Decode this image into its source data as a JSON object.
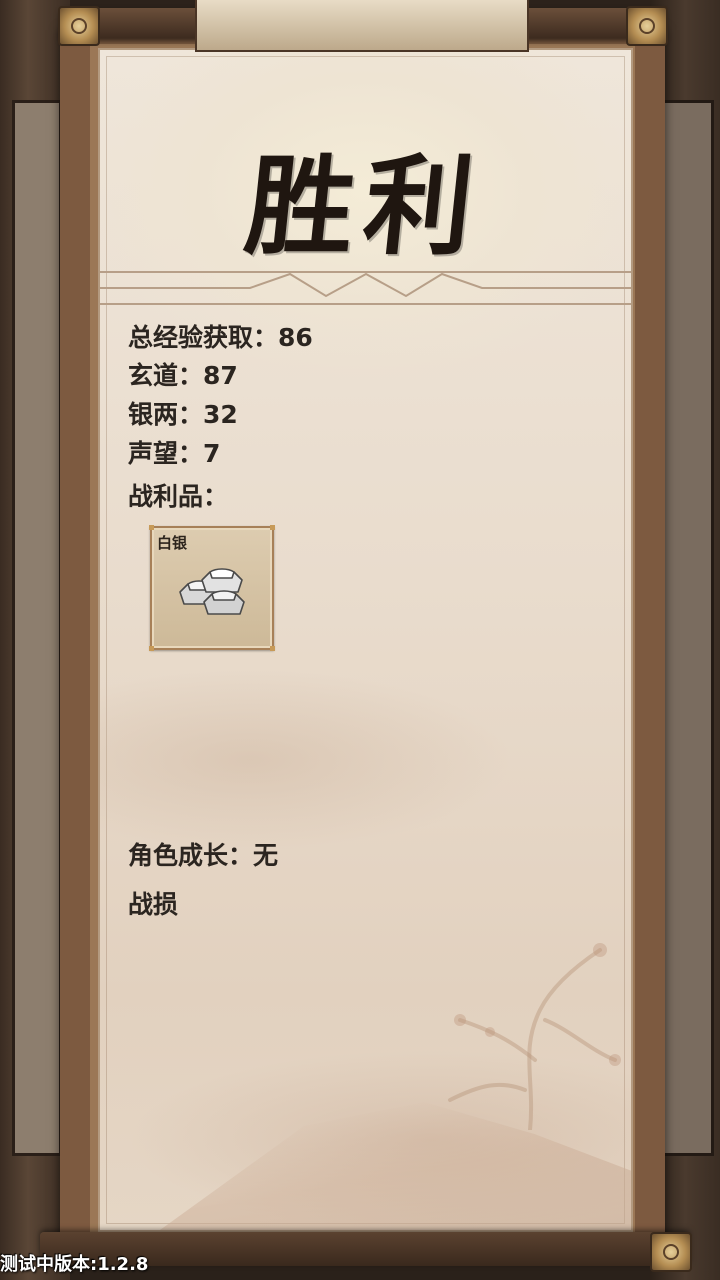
{
  "result": {
    "title": "胜利"
  },
  "stats": {
    "total_exp": "总经验获取：86",
    "xuandao": "玄道：87",
    "silver": "银两：32",
    "reputation": "声望：7",
    "loot_label": "战利品："
  },
  "loot": [
    {
      "name": "白银",
      "icon": "silver-ingots-icon"
    }
  ],
  "growth": "角色成长：无",
  "losses": "战损",
  "footer": {
    "version": "测试中版本:1.2.8"
  },
  "colors": {
    "paper": "#efe6da",
    "frame": "#7d5a40",
    "ink": "#1f1610",
    "text": "#2b2520",
    "loot_card": "#ddccb0"
  }
}
